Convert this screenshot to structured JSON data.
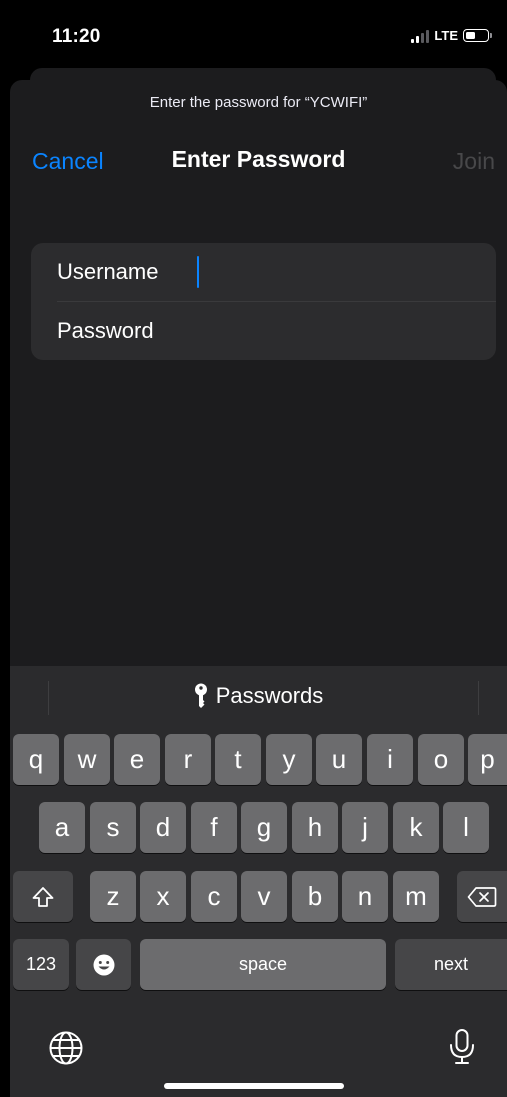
{
  "status_bar": {
    "time": "11:20",
    "network": "LTE"
  },
  "sheet": {
    "prompt": "Enter the password for “YCWIFI”",
    "cancel_label": "Cancel",
    "title": "Enter Password",
    "join_label": "Join"
  },
  "form": {
    "username_placeholder": "Username",
    "password_placeholder": "Password"
  },
  "keyboard": {
    "suggestion": "Passwords",
    "row1": [
      "q",
      "w",
      "e",
      "r",
      "t",
      "y",
      "u",
      "i",
      "o",
      "p"
    ],
    "row2": [
      "a",
      "s",
      "d",
      "f",
      "g",
      "h",
      "j",
      "k",
      "l"
    ],
    "row3": [
      "z",
      "x",
      "c",
      "v",
      "b",
      "n",
      "m"
    ],
    "numbers_label": "123",
    "space_label": "space",
    "next_label": "next"
  },
  "colors": {
    "accent": "#0a84ff",
    "sheet_bg": "#1c1c1e",
    "key_bg": "#6c6c6e",
    "key_dark_bg": "#464648"
  },
  "icons": [
    "key-icon",
    "shift-icon",
    "delete-icon",
    "emoji-icon",
    "globe-icon",
    "microphone-icon",
    "battery-icon",
    "signal-icon"
  ]
}
